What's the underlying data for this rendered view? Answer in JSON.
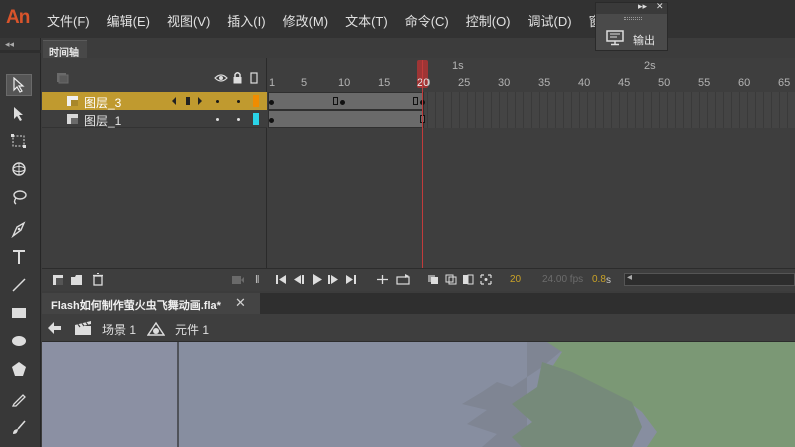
{
  "app": {
    "logo": "An"
  },
  "menu": [
    "文件(F)",
    "编辑(E)",
    "视图(V)",
    "插入(I)",
    "修改(M)",
    "文本(T)",
    "命令(C)",
    "控制(O)",
    "调试(D)",
    "窗口("
  ],
  "output_panel": {
    "label": "输出",
    "collapse_glyph": "▸▸",
    "close_glyph": "✕"
  },
  "toolbar": {
    "collapse_glyph": "◂◂"
  },
  "timeline": {
    "tab_label": "时间轴",
    "layers": [
      {
        "name": "图层_3",
        "selected": true,
        "color": "#f08c00"
      },
      {
        "name": "图层_1",
        "selected": false,
        "color": "#2ad4e8"
      }
    ],
    "ruler": {
      "frames": [
        "1",
        "5",
        "10",
        "15",
        "20",
        "25",
        "30",
        "35",
        "40",
        "45",
        "50",
        "55",
        "60",
        "65"
      ],
      "seconds": [
        "1s",
        "2s"
      ]
    },
    "current_frame": "20",
    "footer": {
      "frame": "20",
      "fps": "24.00 fps",
      "time": "0.8",
      "time_unit": "s"
    }
  },
  "document": {
    "tab_label": "Flash如何制作萤火虫飞舞动画.fla*",
    "close_glyph": "✕",
    "breadcrumb": [
      {
        "label": "场景 1"
      },
      {
        "label": "元件 1"
      }
    ]
  },
  "colors": {
    "accent_orange": "#d9542b",
    "selected_layer": "#c09a2f",
    "playhead": "#c23b3b",
    "stage_bg": "#878ea0",
    "stage_green": "#7b9875"
  }
}
